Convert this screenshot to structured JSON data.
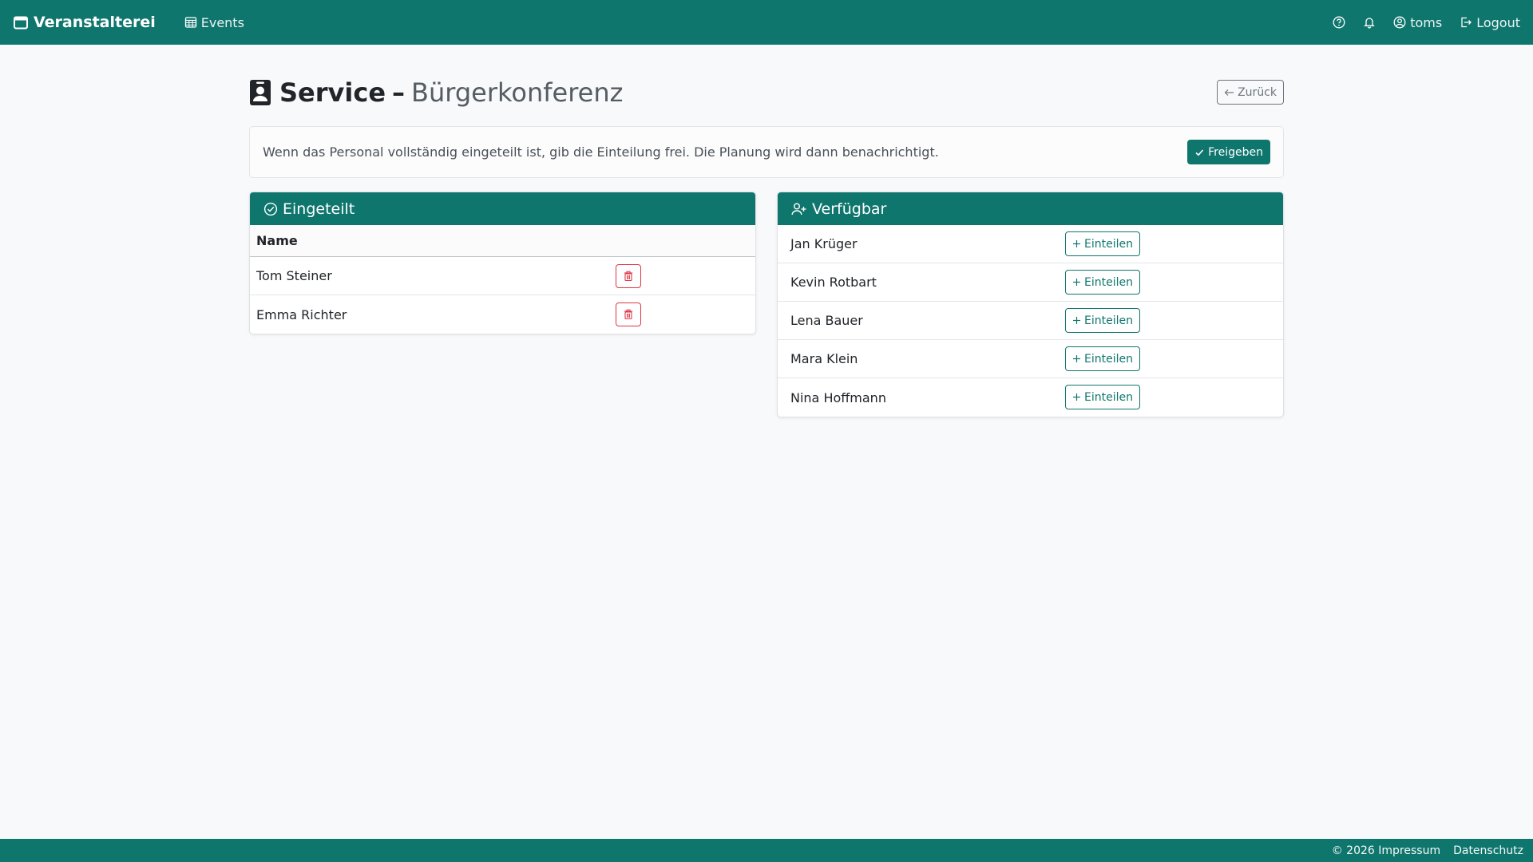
{
  "navbar": {
    "brand": "Veranstalterei",
    "events_label": "Events",
    "user_label": "toms",
    "logout_label": "Logout"
  },
  "page": {
    "title_main": "Service",
    "title_dash": "–",
    "title_event": "Bürgerkonferenz",
    "back_label": "Zurück"
  },
  "notice": {
    "text": "Wenn das Personal vollständig eingeteilt ist, gib die Einteilung frei. Die Planung wird dann benachrichtigt.",
    "release_label": "Freigeben"
  },
  "assigned": {
    "title": "Eingeteilt",
    "column_name": "Name",
    "rows": [
      "Tom Steiner",
      "Emma Richter"
    ]
  },
  "available": {
    "title": "Verfügbar",
    "assign_label": "Einteilen",
    "rows": [
      "Jan Krüger",
      "Kevin Rotbart",
      "Lena Bauer",
      "Mara Klein",
      "Nina Hoffmann"
    ]
  },
  "footer": {
    "copyright": "© 2026 Impressum",
    "privacy": "Datenschutz"
  },
  "colors": {
    "brand": "#0f766e",
    "danger": "#dc3545",
    "background": "#f8f9fa"
  }
}
